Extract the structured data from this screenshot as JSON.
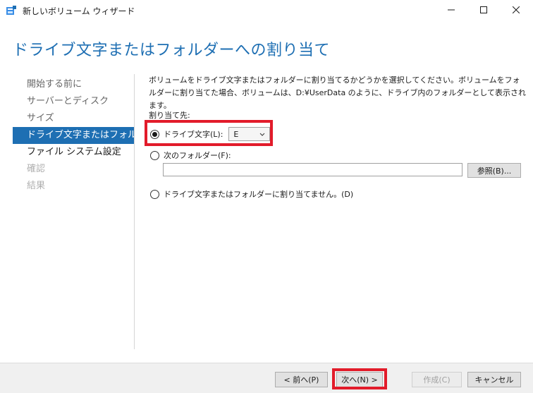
{
  "window": {
    "title": "新しいボリューム ウィザード"
  },
  "page": {
    "heading": "ドライブ文字またはフォルダーへの割り当て"
  },
  "nav": {
    "items": [
      {
        "label": "開始する前に",
        "state": "visited"
      },
      {
        "label": "サーバーとディスク",
        "state": "visited"
      },
      {
        "label": "サイズ",
        "state": "visited"
      },
      {
        "label": "ドライブ文字またはフォルダー",
        "state": "active"
      },
      {
        "label": "ファイル システム設定",
        "state": "normal"
      },
      {
        "label": "確認",
        "state": "disabled"
      },
      {
        "label": "結果",
        "state": "disabled"
      }
    ]
  },
  "content": {
    "description": "ボリュームをドライブ文字またはフォルダーに割り当てるかどうかを選択してください。ボリュームをフォルダーに割り当てた場合、ボリュームは、D:¥UserData のように、ドライブ内のフォルダーとして表示されます。",
    "assign_label": "割り当て先:",
    "option_drive_letter": "ドライブ文字(L):",
    "drive_letter_value": "E",
    "option_folder": "次のフォルダー(F):",
    "folder_value": "",
    "browse_label": "参照(B)...",
    "option_none": "ドライブ文字またはフォルダーに割り当てません。(D)",
    "selected_option": "drive_letter"
  },
  "footer": {
    "back_label": "< 前へ(P)",
    "next_label": "次へ(N) >",
    "create_label": "作成(C)",
    "cancel_label": "キャンセル"
  },
  "colors": {
    "accent": "#1e6fb3",
    "highlight": "#e21b2a"
  },
  "icons": {
    "app": "volume-wizard-icon",
    "minimize": "minimize-icon",
    "maximize": "maximize-icon",
    "close": "close-icon",
    "dropdown": "chevron-down-icon"
  }
}
